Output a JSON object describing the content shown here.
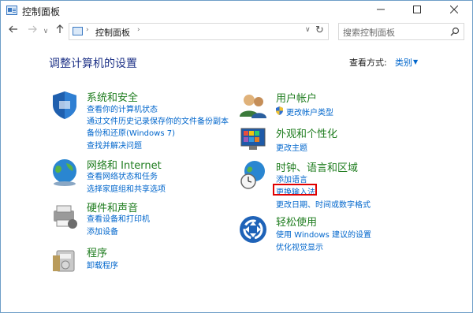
{
  "window": {
    "title": "控制面板"
  },
  "address": {
    "path": "控制面板"
  },
  "search": {
    "placeholder": "搜索控制面板"
  },
  "heading": "调整计算机的设置",
  "view_by": {
    "label": "查看方式:",
    "value": "类别"
  },
  "left": [
    {
      "title": "系统和安全",
      "links": [
        "查看你的计算机状态",
        "通过文件历史记录保存你的文件备份副本",
        "备份和还原(Windows 7)",
        "查找并解决问题"
      ]
    },
    {
      "title": "网络和 Internet",
      "links": [
        "查看网络状态和任务",
        "选择家庭组和共享选项"
      ]
    },
    {
      "title": "硬件和声音",
      "links": [
        "查看设备和打印机",
        "添加设备"
      ]
    },
    {
      "title": "程序",
      "links": [
        "卸载程序"
      ]
    }
  ],
  "right": [
    {
      "title": "用户帐户",
      "links": [
        "更改帐户类型"
      ]
    },
    {
      "title": "外观和个性化",
      "links": [
        "更改主题"
      ]
    },
    {
      "title": "时钟、语言和区域",
      "links": [
        "添加语言",
        "更换输入法",
        "更改日期、时间或数字格式"
      ]
    },
    {
      "title": "轻松使用",
      "links": [
        "使用 Windows 建议的设置",
        "优化视觉显示"
      ]
    }
  ],
  "colors": {
    "category": "#1e7c1e",
    "link": "#0066cc",
    "heading": "#1e3287",
    "highlight": "#e00000"
  }
}
